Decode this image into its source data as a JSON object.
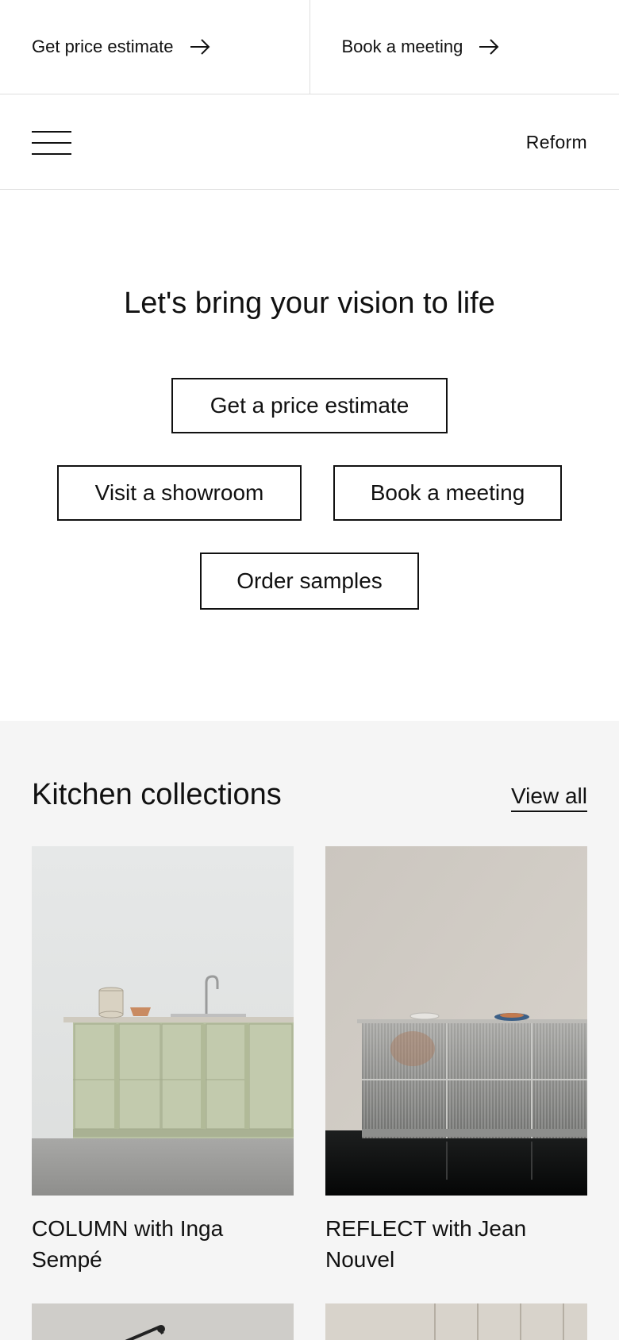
{
  "topbar": {
    "price_label": "Get price estimate",
    "meeting_label": "Book a meeting"
  },
  "navbar": {
    "brand": "Reform"
  },
  "hero": {
    "title": "Let's bring your vision to life",
    "buttons": {
      "price": "Get a price estimate",
      "showroom": "Visit a showroom",
      "meeting": "Book a meeting",
      "samples": "Order samples"
    }
  },
  "collections": {
    "title": "Kitchen collections",
    "view_all": "View all",
    "items": [
      {
        "label": "COLUMN with Inga Sempé"
      },
      {
        "label": "REFLECT with Jean Nouvel"
      }
    ]
  },
  "colors": {
    "text": "#111111",
    "divider": "#dedede",
    "collections_bg": "#f5f5f5"
  },
  "icons": [
    "arrow-right-icon",
    "hamburger-menu-icon"
  ]
}
